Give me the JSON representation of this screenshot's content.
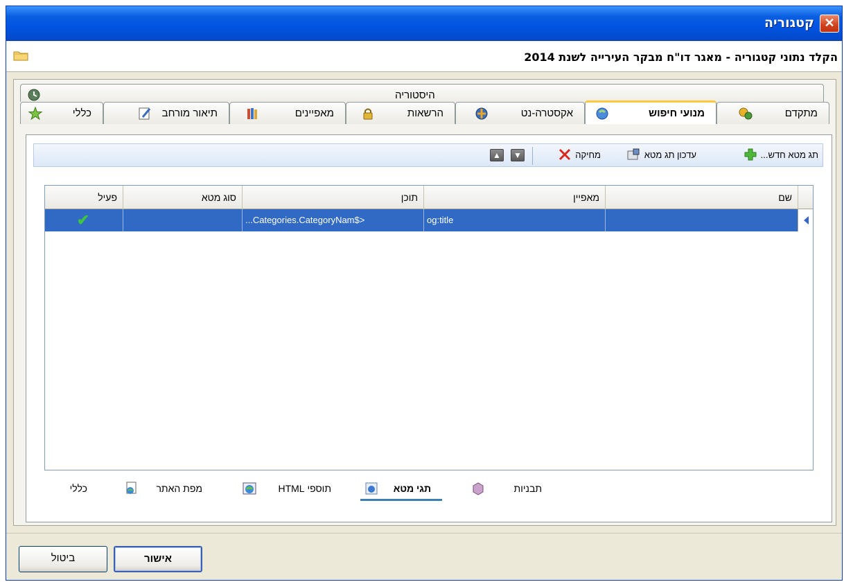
{
  "window": {
    "title": "קטגוריה",
    "close_glyph": "✕"
  },
  "header": {
    "title": "הקלד נתוני קטגוריה - מאגר דו\"ח מבקר העירייה לשנת 2014",
    "icon": "folder-icon"
  },
  "top_tabs": {
    "history_label": "היסטוריה",
    "tabs": [
      {
        "label": "מתקדם",
        "icon": "advanced-icon"
      },
      {
        "label": "מנועי חיפוש",
        "icon": "search-engine-icon",
        "active": true
      },
      {
        "label": "אקסטרה-נט",
        "icon": "extranet-icon"
      },
      {
        "label": "הרשאות",
        "icon": "lock-icon"
      },
      {
        "label": "מאפיינים",
        "icon": "books-icon"
      },
      {
        "label": "תיאור מורחב",
        "icon": "edit-icon"
      },
      {
        "label": "כללי",
        "icon": "star-icon"
      }
    ]
  },
  "toolbar": {
    "new_label": "תג מטא חדש...",
    "update_label": "עדכון תג מטא",
    "delete_label": "מחיקה",
    "up_glyph": "▲",
    "down_glyph": "▼"
  },
  "grid": {
    "columns": [
      "שם",
      "מאפיין",
      "תוכן",
      "סוג מטא",
      "פעיל"
    ],
    "rows": [
      {
        "name": "",
        "property": "og:title",
        "content": "...Categories.CategoryNam$>",
        "meta_type": "",
        "active": "✔"
      }
    ]
  },
  "bottom_tabs": {
    "tabs": [
      {
        "label": "תבניות",
        "icon": "templates-icon"
      },
      {
        "label": "תגי מטא",
        "icon": "meta-tags-icon",
        "active": true
      },
      {
        "label": "תוספי HTML",
        "icon": "globe-icon"
      },
      {
        "label": "מפת האתר",
        "icon": "sitemap-icon"
      },
      {
        "label": "כללי",
        "icon": ""
      }
    ]
  },
  "footer": {
    "ok_label": "אישור",
    "cancel_label": "ביטול"
  },
  "colors": {
    "titlebar": "#0054e3",
    "selection": "#316ac5",
    "active_tab_accent": "#ffc83c",
    "check": "#1e9a1e"
  }
}
